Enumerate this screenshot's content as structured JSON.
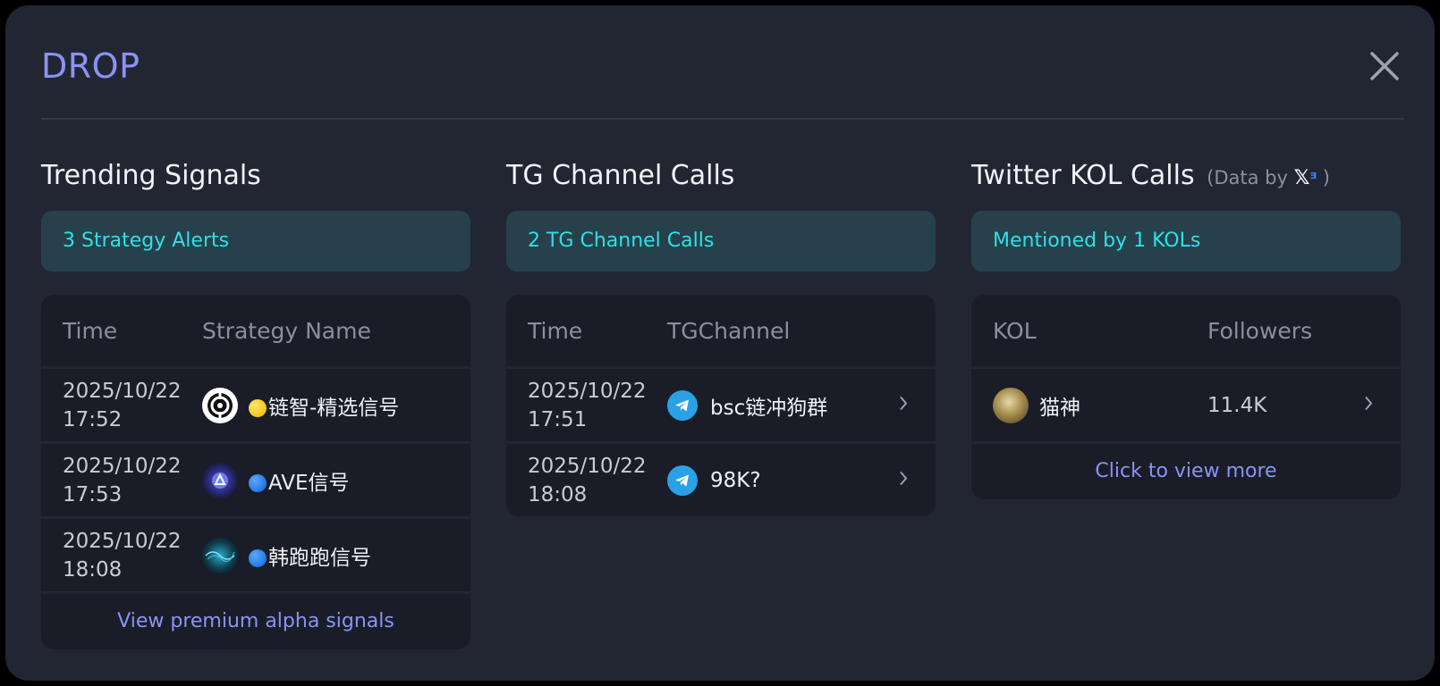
{
  "modal": {
    "title": "DROP"
  },
  "trending": {
    "title": "Trending Signals",
    "banner": "3 Strategy Alerts",
    "headers": [
      "Time",
      "Strategy Name"
    ],
    "rows": [
      {
        "date": "2025/10/22",
        "time": "17:52",
        "name": "链智-精选信号",
        "dot": "yellow",
        "avatar": "linkzhi-logo-icon"
      },
      {
        "date": "2025/10/22",
        "time": "17:53",
        "name": "AVE信号",
        "dot": "blue",
        "avatar": "ave-logo-icon"
      },
      {
        "date": "2025/10/22",
        "time": "18:08",
        "name": "韩跑跑信号",
        "dot": "blue",
        "avatar": "hanpaopao-logo-icon"
      }
    ],
    "footer_link": "View premium alpha signals"
  },
  "tg": {
    "title": "TG Channel Calls",
    "banner": "2 TG Channel Calls",
    "headers": [
      "Time",
      "TGChannel"
    ],
    "rows": [
      {
        "date": "2025/10/22",
        "time": "17:51",
        "name": "bsc链冲狗群",
        "avatar": "telegram-icon"
      },
      {
        "date": "2025/10/22",
        "time": "18:08",
        "name": "98K?",
        "avatar": "telegram-icon"
      }
    ]
  },
  "twitter": {
    "title": "Twitter KOL Calls",
    "data_by_prefix": "(Data by",
    "data_by_suffix": ")",
    "logo_text": "X3",
    "banner": "Mentioned by 1 KOLs",
    "headers": [
      "KOL",
      "Followers"
    ],
    "rows": [
      {
        "name": "猫神",
        "followers": "11.4K",
        "avatar": "cat-avatar-icon"
      }
    ],
    "footer_link": "Click to view more"
  },
  "colors": {
    "accent": "#8a93f3",
    "banner_text": "#2fe0e6",
    "background": "#222633"
  }
}
